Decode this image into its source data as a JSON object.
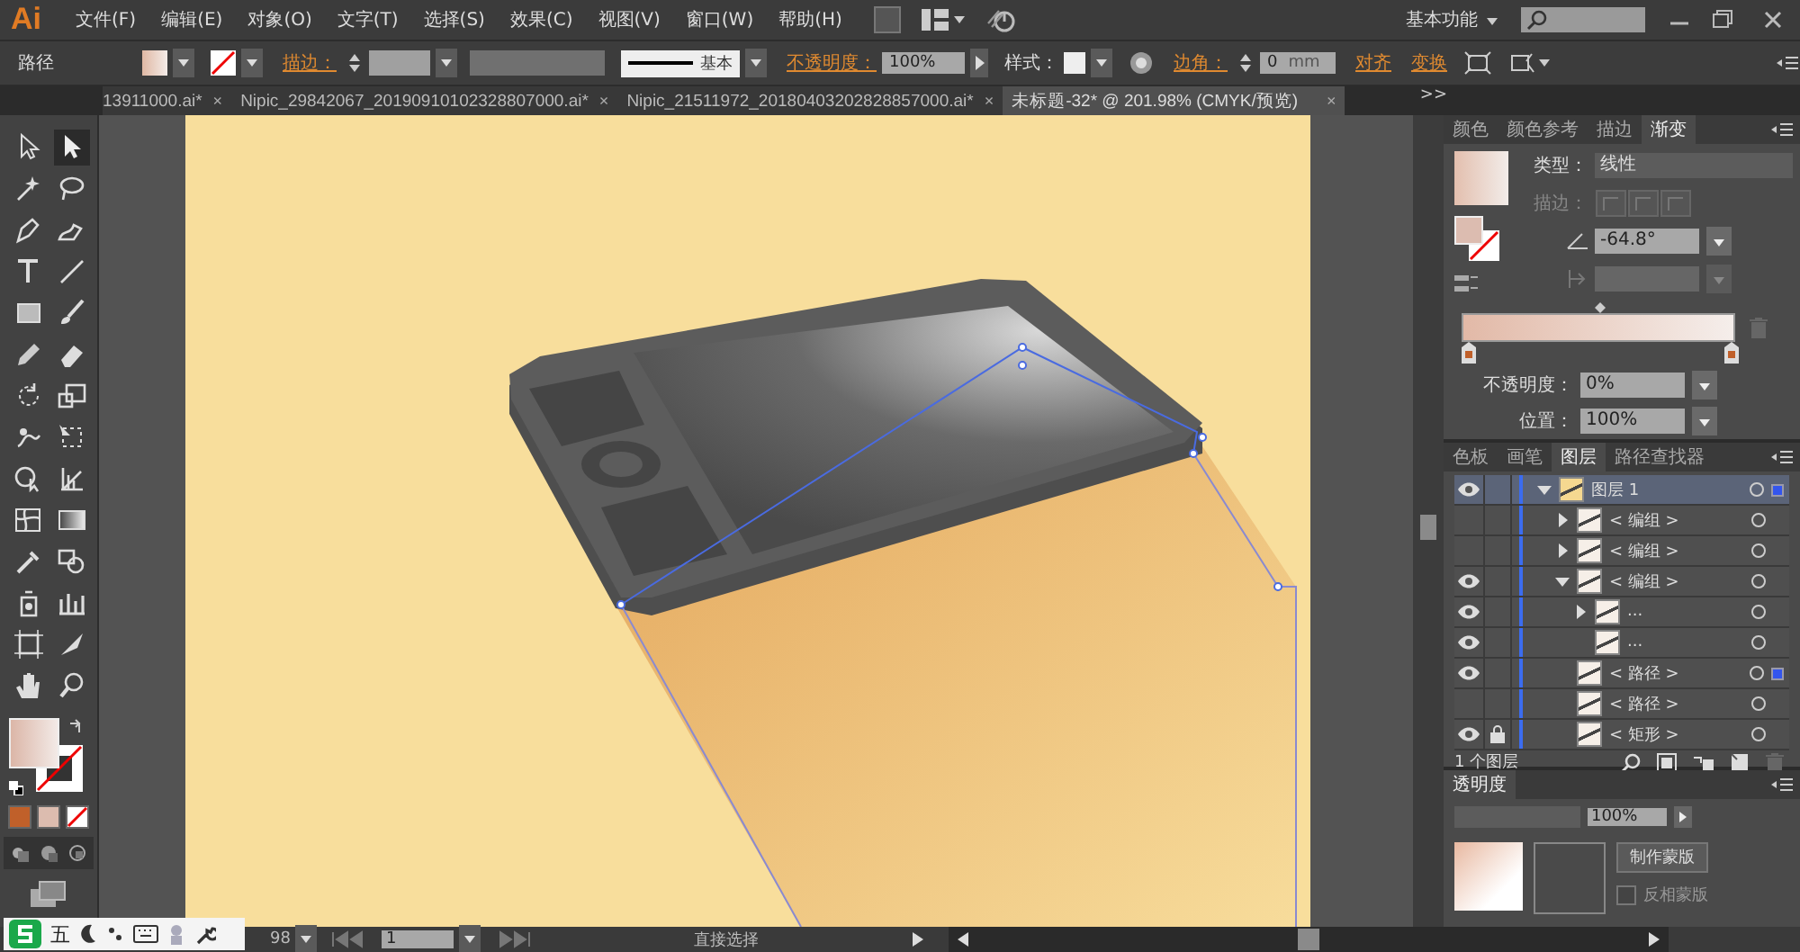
{
  "menu_bar": {
    "logo": "Ai",
    "items": [
      "文件(F)",
      "编辑(E)",
      "对象(O)",
      "文字(T)",
      "选择(S)",
      "效果(C)",
      "视图(V)",
      "窗口(W)",
      "帮助(H)"
    ],
    "workspace": "基本功能"
  },
  "control_bar": {
    "selection_label": "路径",
    "stroke_label": "描边：",
    "stroke_style": "基本",
    "opacity_label": "不透明度：",
    "opacity_value": "100%",
    "style_label": "样式：",
    "corner_label": "边角：",
    "corner_value": "0",
    "corner_unit": "mm",
    "align_link": "对齐",
    "transform_link": "变换"
  },
  "doc_tabs": [
    {
      "title": "13911000.ai*",
      "close": "×",
      "selected": false
    },
    {
      "title": "Nipic_29842067_20190910102328807000.ai*",
      "close": "×",
      "selected": false
    },
    {
      "title": "Nipic_21511972_20180403202828857000.ai*",
      "close": "×",
      "selected": false
    },
    {
      "title": "未标题-32* @ 201.98% (CMYK/预览)",
      "close": "×",
      "selected": true
    }
  ],
  "doc_tabs_overflow": ">>",
  "gradient_panel": {
    "tabs": [
      {
        "label": "颜色",
        "selected": false
      },
      {
        "label": "颜色参考",
        "selected": false
      },
      {
        "label": "描边",
        "selected": false
      },
      {
        "label": "渐变",
        "selected": true
      }
    ],
    "type_label": "类型：",
    "type_value": "线性",
    "stroke_label": "描边：",
    "angle_value": "-64.8°",
    "opacity_label": "不透明度：",
    "opacity_value": "0%",
    "location_label": "位置：",
    "location_value": "100%"
  },
  "layers_panel": {
    "tabs": [
      {
        "label": "色板",
        "selected": false
      },
      {
        "label": "画笔",
        "selected": false
      },
      {
        "label": "图层",
        "selected": true
      },
      {
        "label": "路径查找器",
        "selected": false
      }
    ],
    "layers": [
      {
        "name": "图层 1",
        "kind": "layer",
        "visible": true,
        "locked": false,
        "expanded": true,
        "selected": true,
        "children": [
          {
            "name": "< 编组 >",
            "visible": false,
            "locked": false,
            "expanded": false,
            "selected": false
          },
          {
            "name": "< 编组 >",
            "visible": false,
            "locked": false,
            "expanded": false,
            "selected": false
          },
          {
            "name": "< 编组 >",
            "visible": true,
            "locked": false,
            "expanded": true,
            "selected": false,
            "children": [
              {
                "name": "...",
                "visible": true,
                "locked": false,
                "expanded": false,
                "selected": false
              },
              {
                "name": "...",
                "visible": true,
                "locked": false,
                "selected": false
              }
            ]
          },
          {
            "name": "< 路径 >",
            "visible": true,
            "locked": false,
            "selected": true
          },
          {
            "name": "< 路径 >",
            "visible": false,
            "locked": false,
            "selected": false
          },
          {
            "name": "< 矩形 >",
            "visible": true,
            "locked": true,
            "selected": false
          }
        ]
      }
    ],
    "footer": "1 个图层"
  },
  "transparency_panel": {
    "tab": "透明度",
    "opacity_value": "100%",
    "make_mask": "制作蒙版",
    "invert_mask": {
      "label": "反相蒙版",
      "checked": false
    }
  },
  "status_bar": {
    "zoom": "98",
    "artboard": "1",
    "tool": "直接选择"
  },
  "ime_bar": {
    "mode": "五"
  }
}
